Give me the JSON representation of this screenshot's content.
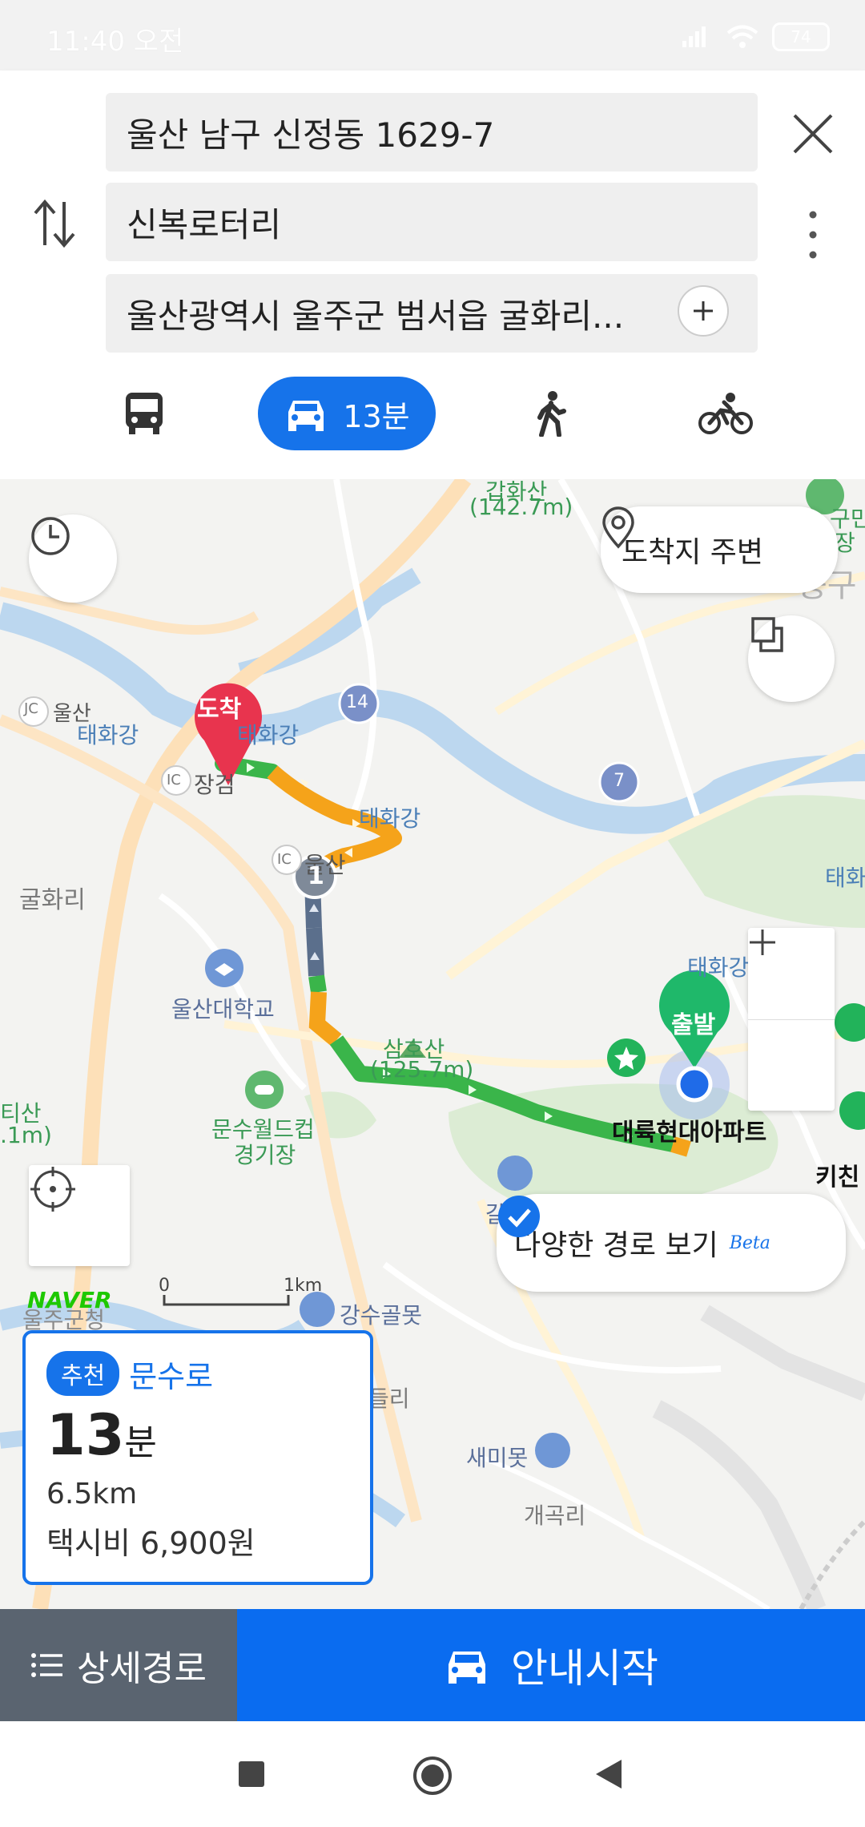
{
  "status_bar": {
    "time": "11:40 오전",
    "battery": "74"
  },
  "route_inputs": {
    "origin": "울산 남구 신정동 1629-7",
    "waypoint": "신복로터리",
    "destination": "울산광역시 울주군 범서읍 굴화리..."
  },
  "modes": {
    "car_label": "13분"
  },
  "map": {
    "labels": {
      "top_peak": "(142.7m)",
      "top_peak_cut": "갑화산",
      "taehwa1": "울산",
      "taehwa1b": "태화강",
      "jc": "JC",
      "taehwa2": "태화강",
      "taehwa3": "태화강",
      "taehwa4": "태화강",
      "taehwa5": "태화",
      "ic1": "IC",
      "ic1_name": "장검",
      "ic2": "IC",
      "ic2_name": "울산",
      "gulhwari": "굴화리",
      "univ": "울산대학교",
      "samhosan": "삼호산",
      "samhosan_h": "(125.7m)",
      "worldcup": "문수월드컵",
      "worldcup2": "경기장",
      "apt": "대륙현대아파트",
      "kitchen": "키친",
      "galti": "갈티모",
      "gangsu": "강수골못",
      "saemi": "새미못",
      "gaegok": "개곡리",
      "deuri": "들리",
      "left_peak": "티산",
      "left_peak_h": ".1m)",
      "right_edge1": "구민",
      "right_edge2": "장",
      "right_edge3": "중구",
      "bottom_left": "울주군청",
      "road14": "14",
      "road7": "7",
      "waypoint_num": "1",
      "naver": "NAVER",
      "scale_0": "0",
      "scale_1": "1km"
    },
    "markers": {
      "arrival": "도착",
      "departure": "출발"
    },
    "dest_nearby": "도착지 주변",
    "alt_routes": "다양한 경로 보기",
    "alt_routes_beta": "Beta"
  },
  "route_card": {
    "badge": "추천",
    "road": "문수로",
    "duration": "13",
    "duration_unit": "분",
    "distance": "6.5km",
    "taxi_fare": "택시비 6,900원"
  },
  "bottom": {
    "detail": "상세경로",
    "start": "안내시작"
  },
  "colors": {
    "accent": "#1673ea",
    "route_green": "#3ab54a",
    "route_orange": "#f5a31a",
    "route_slate": "#5b6f8c",
    "arrival_pin": "#e8344e",
    "departure_pin": "#1fb86a"
  }
}
